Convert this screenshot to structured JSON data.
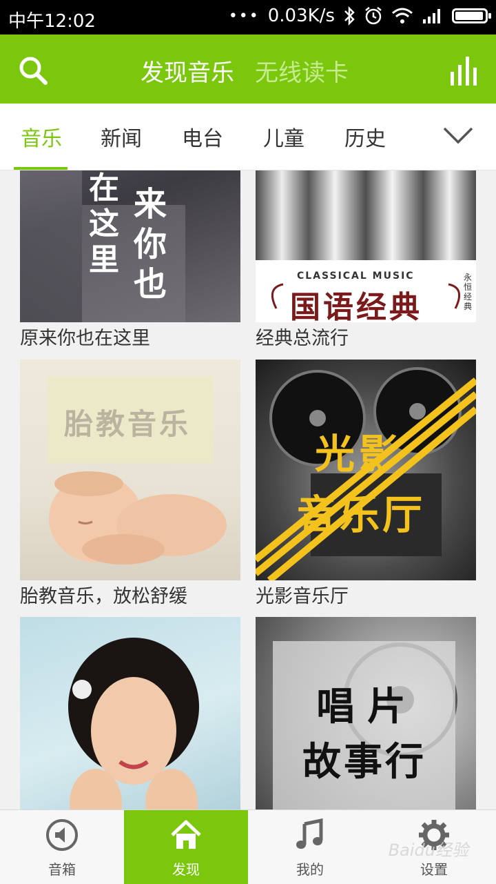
{
  "status_bar": {
    "time": "中午12:02",
    "dots": "•••",
    "speed": "0.03K/s"
  },
  "header": {
    "title_active": "发现音乐",
    "title_inactive": "无线读卡",
    "accent_color": "#7ac70d"
  },
  "tabs": [
    {
      "label": "音乐",
      "active": true
    },
    {
      "label": "新闻"
    },
    {
      "label": "电台"
    },
    {
      "label": "儿童"
    },
    {
      "label": "历史"
    }
  ],
  "cards": [
    {
      "label": "原来你也在这里",
      "cover_text": [
        "在",
        "这",
        "里",
        "来",
        "你",
        "也"
      ]
    },
    {
      "label": "经典总流行",
      "cover_text": [
        "CLASSICAL MUSIC",
        "国语经典",
        "永恒经典"
      ]
    },
    {
      "label": "胎教音乐，放松舒缓",
      "cover_text": [
        "胎教音乐"
      ]
    },
    {
      "label": "光影音乐厅",
      "cover_text": [
        "光影",
        "音乐厅"
      ]
    },
    {
      "label": "",
      "cover_text": []
    },
    {
      "label": "",
      "cover_text": [
        "唱片",
        "故事行"
      ]
    }
  ],
  "bottom_nav": [
    {
      "label": "音箱",
      "icon": "speaker-icon"
    },
    {
      "label": "发现",
      "icon": "home-icon",
      "active": true
    },
    {
      "label": "我的",
      "icon": "music-note-icon"
    },
    {
      "label": "设置",
      "icon": "gear-icon"
    }
  ],
  "watermark": "Baidu经验"
}
